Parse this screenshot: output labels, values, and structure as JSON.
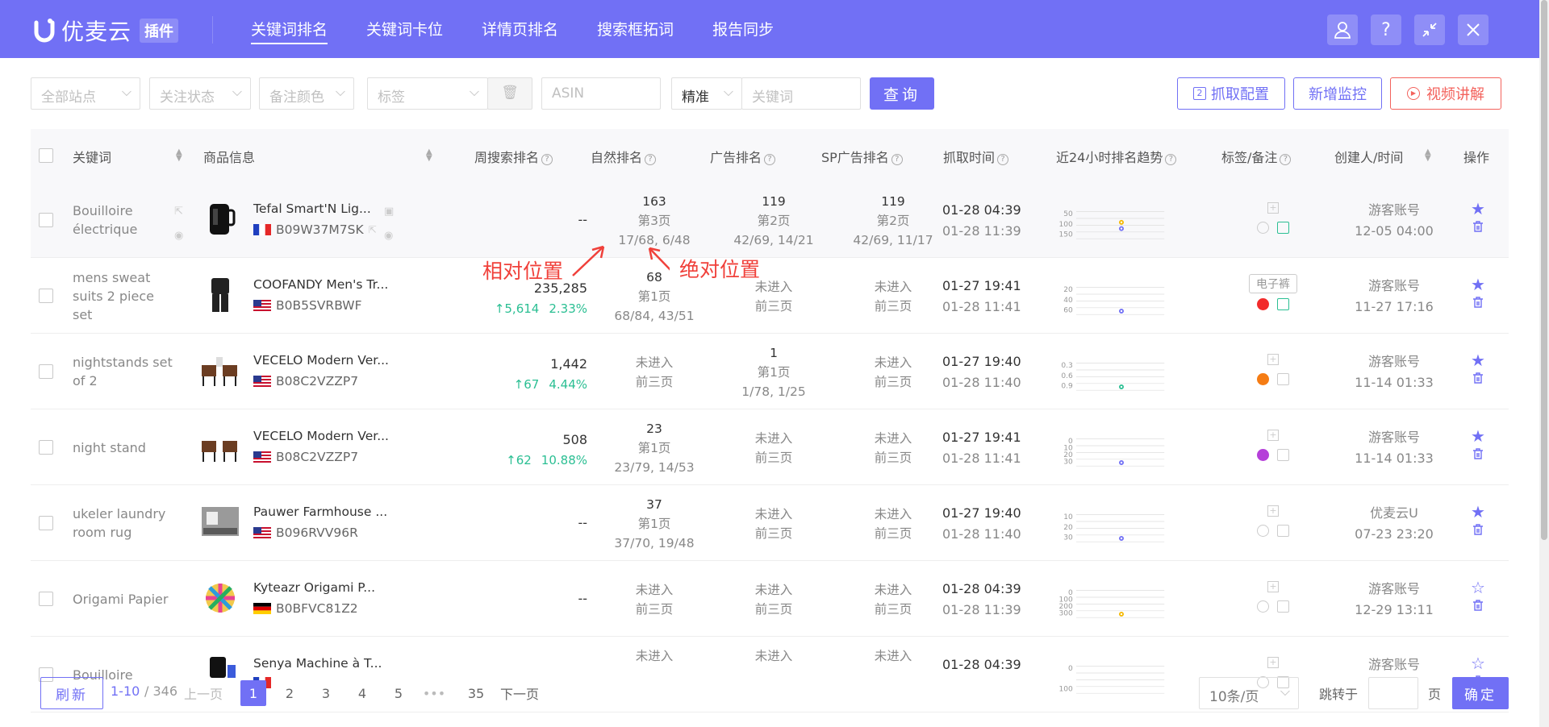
{
  "header": {
    "logo_name": "优麦云",
    "plugin_badge": "插件",
    "nav": [
      "关键词排名",
      "关键词卡位",
      "详情页排名",
      "搜索框拓词",
      "报告同步"
    ],
    "buttons": [
      "user-icon",
      "help-icon",
      "collapse-icon",
      "close-icon"
    ]
  },
  "filters": {
    "site": "全部站点",
    "follow": "关注状态",
    "color": "备注颜色",
    "tag": "标签",
    "asin_placeholder": "ASIN",
    "match": "精准",
    "keyword_placeholder": "关键词",
    "query": "查询",
    "fetch_config": "抓取配置",
    "add_monitor": "新增监控",
    "video": "视频讲解"
  },
  "table": {
    "headers": {
      "keyword": "关键词",
      "product": "商品信息",
      "weekly": "周搜索排名",
      "natural": "自然排名",
      "ad": "广告排名",
      "sp": "SP广告排名",
      "fetch_time": "抓取时间",
      "trend": "近24小时排名趋势",
      "tag": "标签/备注",
      "creator": "创建人/时间",
      "ops": "操作"
    },
    "rows": [
      {
        "keyword": "Bouilloire électrique",
        "title": "Tefal Smart'N Lig...",
        "asin": "B09W37M7SK",
        "flag": "fr",
        "weekly": "--",
        "weekly_up": "",
        "weekly_pct": "",
        "nat": [
          "163",
          "第3页",
          "17/68, 6/48"
        ],
        "ad": [
          "119",
          "第2页",
          "42/69, 14/21"
        ],
        "sp": [
          "119",
          "第2页",
          "42/69, 11/17"
        ],
        "time1": "01-28 04:39",
        "time2": "01-28 11:39",
        "ticks": [
          "50",
          "100",
          "150"
        ],
        "dot_color": "#f5b800",
        "dot2_color": "#7170f5",
        "tag_text": "",
        "note_color": "",
        "creator": "游客账号",
        "created": "12-05 04:00",
        "starred": true
      },
      {
        "keyword": "mens sweat suits 2 piece set",
        "title": "COOFANDY Men's Tr...",
        "asin": "B0B5SVRBWF",
        "flag": "us",
        "weekly": "235,285",
        "weekly_up": "5,614",
        "weekly_pct": "2.33%",
        "nat": [
          "68",
          "第1页",
          "68/84, 43/51"
        ],
        "ad": [
          "未进入",
          "前三页",
          ""
        ],
        "sp": [
          "未进入",
          "前三页",
          ""
        ],
        "time1": "01-27 19:41",
        "time2": "01-28 11:41",
        "ticks": [
          "20",
          "40",
          "60"
        ],
        "dot_color": "#7170f5",
        "dot2_color": "",
        "tag_text": "电子裤",
        "note_color": "#f22b2b",
        "creator": "游客账号",
        "created": "11-27 17:16",
        "starred": true
      },
      {
        "keyword": "nightstands set of 2",
        "title": "VECELO Modern Ver...",
        "asin": "B08C2VZZP7",
        "flag": "us",
        "weekly": "1,442",
        "weekly_up": "67",
        "weekly_pct": "4.44%",
        "nat": [
          "未进入",
          "前三页",
          ""
        ],
        "ad": [
          "1",
          "第1页",
          "1/78, 1/25"
        ],
        "sp": [
          "未进入",
          "前三页",
          ""
        ],
        "time1": "01-27 19:40",
        "time2": "01-28 11:40",
        "ticks": [
          "0.3",
          "0.6",
          "0.9"
        ],
        "dot_color": "#2bbf93",
        "dot2_color": "",
        "tag_text": "",
        "note_color": "#f57c14",
        "creator": "游客账号",
        "created": "11-14 01:33",
        "starred": true
      },
      {
        "keyword": "night stand",
        "title": "VECELO Modern Ver...",
        "asin": "B08C2VZZP7",
        "flag": "us",
        "weekly": "508",
        "weekly_up": "62",
        "weekly_pct": "10.88%",
        "nat": [
          "23",
          "第1页",
          "23/79, 14/53"
        ],
        "ad": [
          "未进入",
          "前三页",
          ""
        ],
        "sp": [
          "未进入",
          "前三页",
          ""
        ],
        "time1": "01-27 19:41",
        "time2": "01-28 11:41",
        "ticks": [
          "0",
          "10",
          "20",
          "30"
        ],
        "dot_color": "#7170f5",
        "dot2_color": "",
        "tag_text": "",
        "note_color": "#b53fd9",
        "creator": "游客账号",
        "created": "11-14 01:33",
        "starred": true
      },
      {
        "keyword": "ukeler laundry room rug",
        "title": "Pauwer Farmhouse ...",
        "asin": "B096RVV96R",
        "flag": "us",
        "weekly": "--",
        "weekly_up": "",
        "weekly_pct": "",
        "nat": [
          "37",
          "第1页",
          "37/70, 19/48"
        ],
        "ad": [
          "未进入",
          "前三页",
          ""
        ],
        "sp": [
          "未进入",
          "前三页",
          ""
        ],
        "time1": "01-27 19:40",
        "time2": "01-28 11:40",
        "ticks": [
          "10",
          "20",
          "30"
        ],
        "dot_color": "#7170f5",
        "dot2_color": "",
        "tag_text": "",
        "note_color": "",
        "creator": "优麦云U",
        "created": "07-23 23:20",
        "starred": true
      },
      {
        "keyword": "Origami Papier",
        "title": "Kyteazr Origami P...",
        "asin": "B0BFVC81Z2",
        "flag": "de",
        "weekly": "--",
        "weekly_up": "",
        "weekly_pct": "",
        "nat": [
          "未进入",
          "前三页",
          ""
        ],
        "ad": [
          "未进入",
          "前三页",
          ""
        ],
        "sp": [
          "未进入",
          "前三页",
          ""
        ],
        "time1": "01-28 04:39",
        "time2": "01-28 11:39",
        "ticks": [
          "0",
          "100",
          "200",
          "300"
        ],
        "dot_color": "#f5b800",
        "dot2_color": "",
        "tag_text": "",
        "note_color": "",
        "creator": "游客账号",
        "created": "12-29 13:11",
        "starred": false
      },
      {
        "keyword": "Bouilloire",
        "title": "Senya Machine à T...",
        "asin": "",
        "flag": "fr",
        "weekly": "",
        "weekly_up": "",
        "weekly_pct": "",
        "nat": [
          "未进入",
          "",
          ""
        ],
        "ad": [
          "未进入",
          "",
          ""
        ],
        "sp": [
          "未进入",
          "",
          ""
        ],
        "time1": "01-28 04:39",
        "time2": "",
        "ticks": [
          "0",
          "100"
        ],
        "dot_color": "",
        "dot2_color": "",
        "tag_text": "",
        "note_color": "",
        "creator": "游客账号",
        "created": "",
        "starred": false
      }
    ]
  },
  "annotations": {
    "relative": "相对位置",
    "absolute": "绝对位置"
  },
  "pagination": {
    "refresh": "刷新",
    "range": "1-10",
    "total": " / 346",
    "prev": "上一页",
    "pages": [
      "1",
      "2",
      "3",
      "4",
      "5",
      "•••",
      "35"
    ],
    "next": "下一页",
    "page_size": "10条/页",
    "jump_label": "跳转于",
    "page_unit": "页",
    "confirm": "确定"
  }
}
